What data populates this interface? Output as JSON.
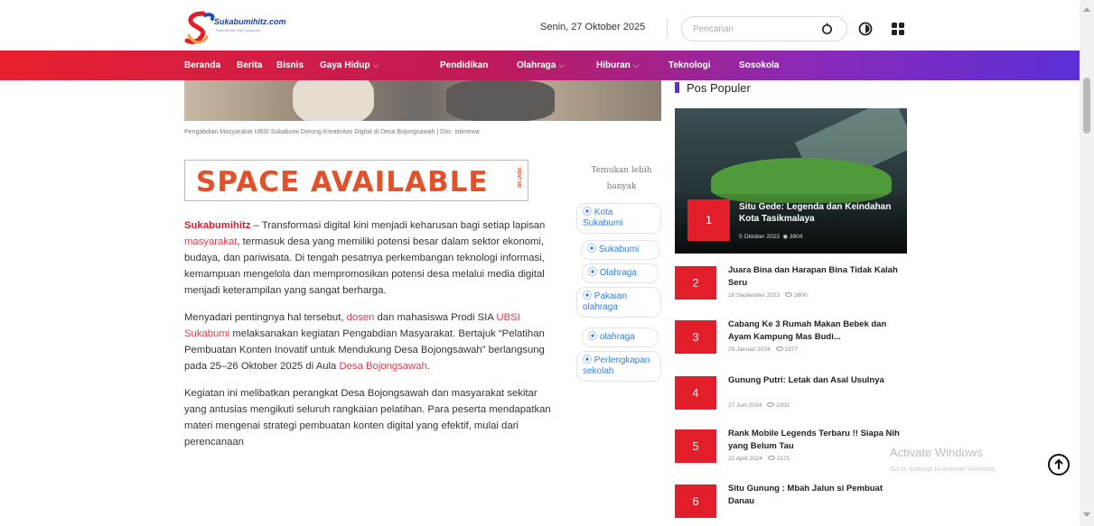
{
  "header": {
    "logo_text": "Sukabumihitz.com",
    "logo_tagline": "Read Berita Viral Sukabumi",
    "date": "Senin, 27 Oktober 2025",
    "search_placeholder": "Pencarian",
    "search_icon": "search-icon",
    "theme_icon": "theme-toggle-icon",
    "menu_icon": "grid-menu-icon"
  },
  "nav": {
    "items": [
      {
        "label": "Beranda",
        "dropdown": false
      },
      {
        "label": "Berita",
        "dropdown": false
      },
      {
        "label": "Bisnis",
        "dropdown": false
      },
      {
        "label": "Gaya Hidup",
        "dropdown": true
      },
      {
        "label": "Pendidikan",
        "dropdown": false
      },
      {
        "label": "Olahraga",
        "dropdown": true
      },
      {
        "label": "Hiburan",
        "dropdown": true
      },
      {
        "label": "Teknologi",
        "dropdown": false
      },
      {
        "label": "Sosokola",
        "dropdown": false
      }
    ],
    "chevron": "⌵"
  },
  "article": {
    "caption": "Pengabdian Masyarakat UBSI Sukabumi Dorong Kreativitas Digital di Desa Bojongsawah | Doc: istimewa",
    "ad_text": "SPACE AVAILABLE",
    "ad_side": "RENT ME",
    "p1": {
      "brand": "Sukabumihitz",
      "a": " – Transformasi digital kini menjadi keharusan bagi setiap lapisan ",
      "link1": "masyarakat",
      "b": ", termasuk desa yang memiliki potensi besar dalam sektor ekonomi, budaya, dan pariwisata. Di tengah pesatnya perkembangan teknologi informasi, kemampuan mengelola dan mempromosikan potensi desa melalui media digital menjadi keterampilan yang sangat berharga."
    },
    "p2": {
      "a": "Menyadari pentingnya hal tersebut, ",
      "link1": "dosen",
      "b": " dan mahasiswa Prodi SIA ",
      "link2": "UBSI Sukabumi",
      "c": " melaksanakan kegiatan Pengabdian Masyarakat. Bertajuk “Pelatihan Pembuatan Konten Inovatif untuk Mendukung Desa Bojongsawah” berlangsung pada 25–26 Oktober 2025 di Aula ",
      "link3": "Desa Bojongsawah",
      "d": "."
    },
    "p3": "Kegiatan ini melibatkan perangkat Desa Bojongsawah dan masyarakat sekitar yang antusias mengikuti seluruh rangkaian pelatihan. Para peserta mendapatkan materi mengenai strategi pembuatan konten digital yang efektif, mulai dari perencanaan"
  },
  "tags": {
    "heading": "Temukan lebih banyak",
    "items": [
      "Kota Sukabumi",
      "Sukabumi",
      "Olahraga",
      "Pakaian olahraga",
      "olahraga",
      "Perlengkapan sekolah"
    ]
  },
  "sidebar": {
    "heading": "Pos Populer",
    "featured": {
      "num": "1",
      "title": "Situ Gede: Legenda dan Keindahan Kota Tasikmalaya",
      "date": "5 Oktober 2023",
      "views": "3804"
    },
    "items": [
      {
        "num": "2",
        "title": "Juara Bina dan Harapan Bina Tidak Kalah Seru",
        "date": "16 September 2023",
        "views": "3800"
      },
      {
        "num": "3",
        "title": "Cabang Ke 3 Rumah Makan Bebek dan Ayam Kampung Mas Budi...",
        "date": "29 Januari 2024",
        "views": "2377"
      },
      {
        "num": "4",
        "title": "Gunung Putri: Letak dan Asal Usulnya",
        "date": "27 Juni 2024",
        "views": "2202"
      },
      {
        "num": "5",
        "title": "Rank Mobile Legends Terbaru !! Siapa Nih yang Belum Tau",
        "date": "22 April 2024",
        "views": "2171"
      },
      {
        "num": "6",
        "title": "Situ Gunung : Mbah Jalun si Pembuat Danau",
        "date": "",
        "views": ""
      }
    ]
  },
  "watermark": {
    "line1": "Activate Windows",
    "line2": "Go to Settings to activate Windows."
  },
  "colors": {
    "brand_red": "#e31e2b",
    "nav_gradient_start": "#e8202d",
    "nav_gradient_end": "#5b2fd8",
    "link_blue": "#2e7df0",
    "ad_orange": "#e1522b"
  }
}
